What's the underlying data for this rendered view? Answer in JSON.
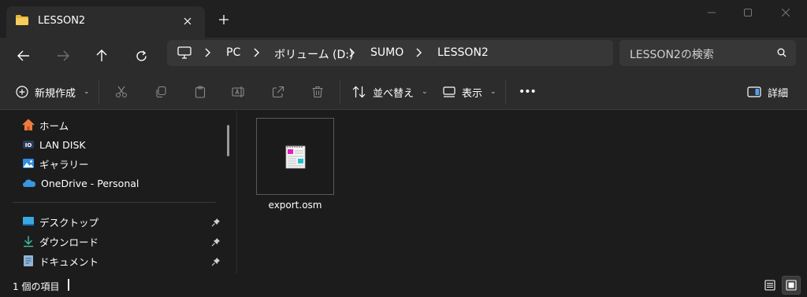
{
  "tab": {
    "title": "LESSON2",
    "folder_icon": "folder-icon",
    "close_icon": "close-icon",
    "new_tab_icon": "plus-icon"
  },
  "window_controls": {
    "minimize": "minimize-icon",
    "maximize": "maximize-icon",
    "close": "close-icon"
  },
  "nav": {
    "back": "arrow-left-icon",
    "forward": "arrow-right-icon",
    "up": "arrow-up-icon",
    "refresh": "refresh-icon",
    "breadcrumbs": [
      "PC",
      "ボリューム (D:)",
      "SUMO",
      "LESSON2"
    ],
    "search_placeholder": "LESSON2の検索"
  },
  "commands": {
    "new_label": "新規作成",
    "sort_label": "並べ替え",
    "view_label": "表示",
    "more_label": "•••",
    "details_label": "詳細"
  },
  "sidebar": {
    "items": [
      {
        "label": "ホーム",
        "icon": "home-icon"
      },
      {
        "label": "LAN DISK",
        "icon": "nas-icon"
      },
      {
        "label": "ギャラリー",
        "icon": "gallery-icon"
      },
      {
        "label": "OneDrive - Personal",
        "icon": "cloud-icon"
      }
    ],
    "pinned": [
      {
        "label": "デスクトップ",
        "icon": "desktop-icon"
      },
      {
        "label": "ダウンロード",
        "icon": "download-icon"
      },
      {
        "label": "ドキュメント",
        "icon": "document-icon"
      }
    ]
  },
  "files": [
    {
      "name": "export.osm",
      "icon": "osm-file-icon"
    }
  ],
  "status": {
    "item_count": "1 個の項目"
  },
  "colors": {
    "background": "#1c1c1c",
    "toolbar": "#2c2c2c",
    "address": "#373737",
    "folder": "#f0c040",
    "onedrive": "#3a96dd"
  }
}
